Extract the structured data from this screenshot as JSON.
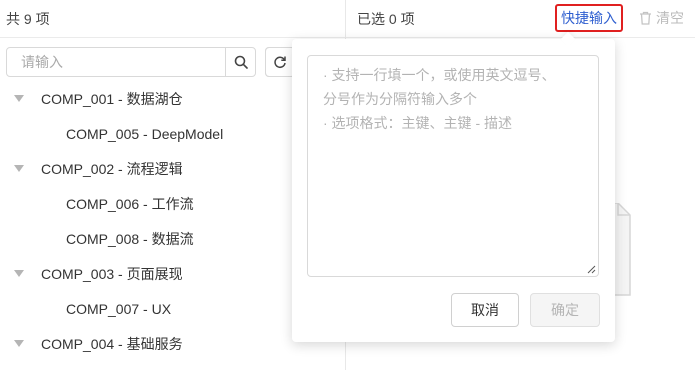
{
  "left": {
    "count_label": "共 9 项",
    "search_placeholder": "请输入",
    "tree": [
      {
        "label": "COMP_001 - 数据湖仓",
        "level": 0
      },
      {
        "label": "COMP_005 - DeepModel",
        "level": 1
      },
      {
        "label": "COMP_002 - 流程逻辑",
        "level": 0
      },
      {
        "label": "COMP_006 - 工作流",
        "level": 1
      },
      {
        "label": "COMP_008 - 数据流",
        "level": 1
      },
      {
        "label": "COMP_003 - 页面展现",
        "level": 0
      },
      {
        "label": "COMP_007 - UX",
        "level": 1
      },
      {
        "label": "COMP_004 - 基础服务",
        "level": 0
      }
    ]
  },
  "right": {
    "selected_label": "已选 0 项",
    "quick_input_label": "快捷输入",
    "clear_label": "清空"
  },
  "popover": {
    "placeholder_lines": [
      "· 支持一行填一个，或使用英文逗号、",
      "分号作为分隔符输入多个",
      "· 选项格式：主键、主键 - 描述"
    ],
    "cancel_label": "取消",
    "ok_label": "确定"
  }
}
